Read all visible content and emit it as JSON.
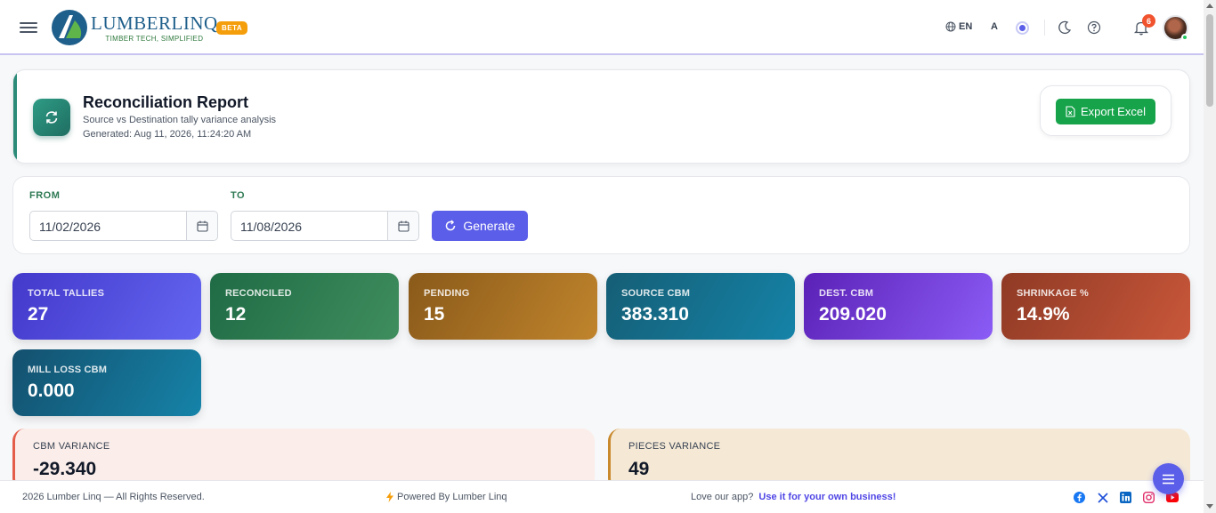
{
  "brand": {
    "name": "LUMBERLINQ",
    "tagline": "TIMBER TECH, SIMPLIFIED",
    "badge": "BETA"
  },
  "topbar": {
    "language": "EN",
    "font_size_label": "A",
    "notification_count": "6"
  },
  "report": {
    "title": "Reconciliation Report",
    "subtitle": "Source vs Destination tally variance analysis",
    "generated": "Generated: Aug 11, 2026, 11:24:20 AM",
    "export_label": "Export Excel"
  },
  "filters": {
    "from_label": "FROM",
    "from_value": "11/02/2026",
    "to_label": "TO",
    "to_value": "11/08/2026",
    "generate_label": "Generate"
  },
  "stats": [
    {
      "label": "TOTAL TALLIES",
      "value": "27",
      "color_from": "#4338ca",
      "color_to": "#6366f1"
    },
    {
      "label": "RECONCILED",
      "value": "12",
      "color_from": "#1f6b45",
      "color_to": "#3f8e5e"
    },
    {
      "label": "PENDING",
      "value": "15",
      "color_from": "#8a5a1a",
      "color_to": "#c0842c"
    },
    {
      "label": "SOURCE CBM",
      "value": "383.310",
      "color_from": "#155e75",
      "color_to": "#1583a8"
    },
    {
      "label": "DEST. CBM",
      "value": "209.020",
      "color_from": "#5b21b6",
      "color_to": "#8b5cf6"
    },
    {
      "label": "SHRINKAGE %",
      "value": "14.9%",
      "color_from": "#8f3a25",
      "color_to": "#c9573a"
    },
    {
      "label": "MILL LOSS CBM",
      "value": "0.000",
      "color_from": "#14506e",
      "color_to": "#1583a8"
    }
  ],
  "variances": [
    {
      "label": "CBM VARIANCE",
      "value": "-29.340",
      "bg": "#fbeeea",
      "accent": "#e35d4a"
    },
    {
      "label": "PIECES VARIANCE",
      "value": "49",
      "bg": "#f5e9d6",
      "accent": "#c98a2e"
    }
  ],
  "footer": {
    "copyright": "2026 Lumber Linq — All Rights Reserved.",
    "powered": "Powered By Lumber Linq",
    "love": "Love our app?",
    "cta": "Use it for your own business!"
  },
  "socials": [
    "facebook-icon",
    "x-icon",
    "linkedin-icon",
    "instagram-icon",
    "youtube-icon"
  ]
}
